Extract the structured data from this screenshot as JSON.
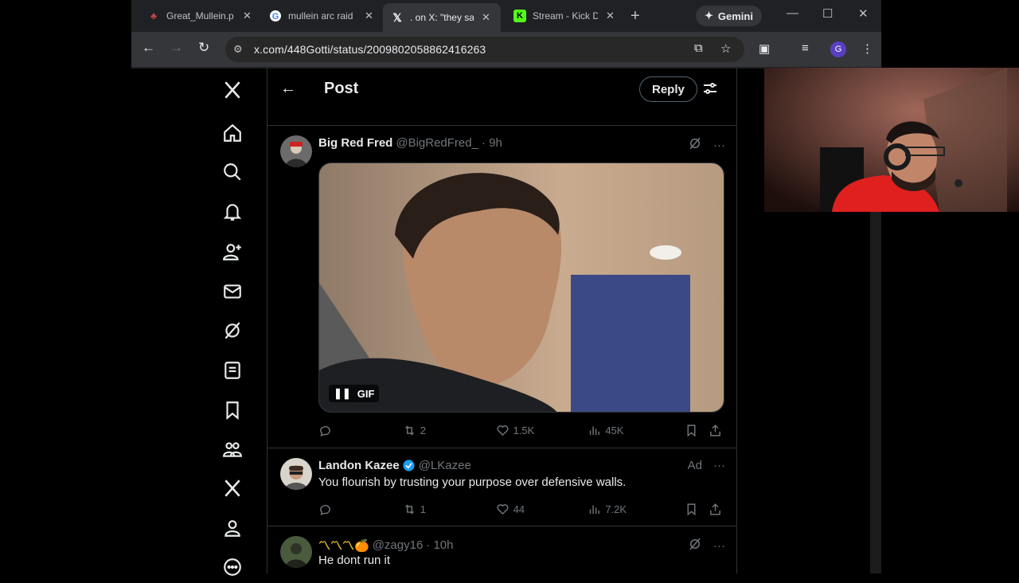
{
  "browser": {
    "tabs": [
      {
        "title": "Great_Mullein.p",
        "favicon": "mullein-favicon"
      },
      {
        "title": "mullein arc raid",
        "favicon": "google-icon"
      },
      {
        "title": ". on X: \"they sai",
        "favicon": "x-logo-icon"
      },
      {
        "title": "Stream - Kick D",
        "favicon": "kick-icon"
      }
    ],
    "gemini_label": "Gemini",
    "url": "x.com/448Gotti/status/2009802058862416263",
    "profile_initial": "G"
  },
  "header": {
    "title": "Post",
    "reply_label": "Reply"
  },
  "tweets": [
    {
      "name": "Big Red Fred",
      "handle": "@BigRedFred_",
      "time": "· 9h",
      "gif_label": "GIF",
      "replies": "",
      "reposts": "2",
      "likes": "1.5K",
      "views": "45K"
    },
    {
      "name": "Landon Kazee",
      "handle": "@LKazee",
      "ad_label": "Ad",
      "text": "You flourish by trusting your purpose over defensive walls.",
      "replies": "",
      "reposts": "1",
      "likes": "44",
      "views": "7.2K"
    },
    {
      "name": "〽〽〽🍊",
      "handle": "@zagy16",
      "time": "· 10h",
      "text": "He dont run it"
    }
  ],
  "colors": {
    "background": "#000000",
    "border": "#2f3336",
    "muted": "#71767b",
    "verified": "#1d9bf0"
  }
}
